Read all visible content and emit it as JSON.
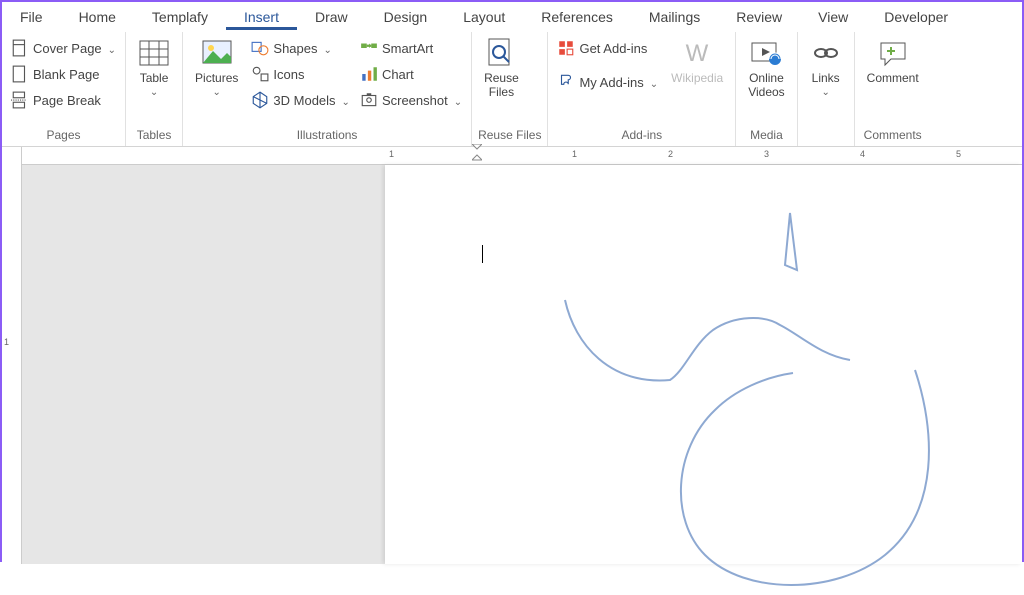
{
  "tabs": {
    "file": "File",
    "home": "Home",
    "templafy": "Templafy",
    "insert": "Insert",
    "draw": "Draw",
    "design": "Design",
    "layout": "Layout",
    "references": "References",
    "mailings": "Mailings",
    "review": "Review",
    "view": "View",
    "developer": "Developer"
  },
  "ribbon": {
    "pages": {
      "cover_page": "Cover Page",
      "blank_page": "Blank Page",
      "page_break": "Page Break",
      "label": "Pages"
    },
    "tables": {
      "table": "Table",
      "label": "Tables"
    },
    "illustrations": {
      "pictures": "Pictures",
      "shapes": "Shapes",
      "icons": "Icons",
      "models": "3D Models",
      "smartart": "SmartArt",
      "chart": "Chart",
      "screenshot": "Screenshot",
      "label": "Illustrations"
    },
    "reuse": {
      "reuse_files": "Reuse\nFiles",
      "label": "Reuse Files"
    },
    "addins": {
      "get": "Get Add-ins",
      "my": "My Add-ins",
      "wikipedia": "Wikipedia",
      "label": "Add-ins"
    },
    "media": {
      "online_videos": "Online\nVideos",
      "label": "Media"
    },
    "links": {
      "links": "Links",
      "label": ""
    },
    "comments": {
      "comment": "Comment",
      "label": "Comments"
    }
  },
  "ruler": {
    "h": [
      "1",
      "2",
      "3",
      "4",
      "5"
    ],
    "v": [
      "1"
    ]
  }
}
